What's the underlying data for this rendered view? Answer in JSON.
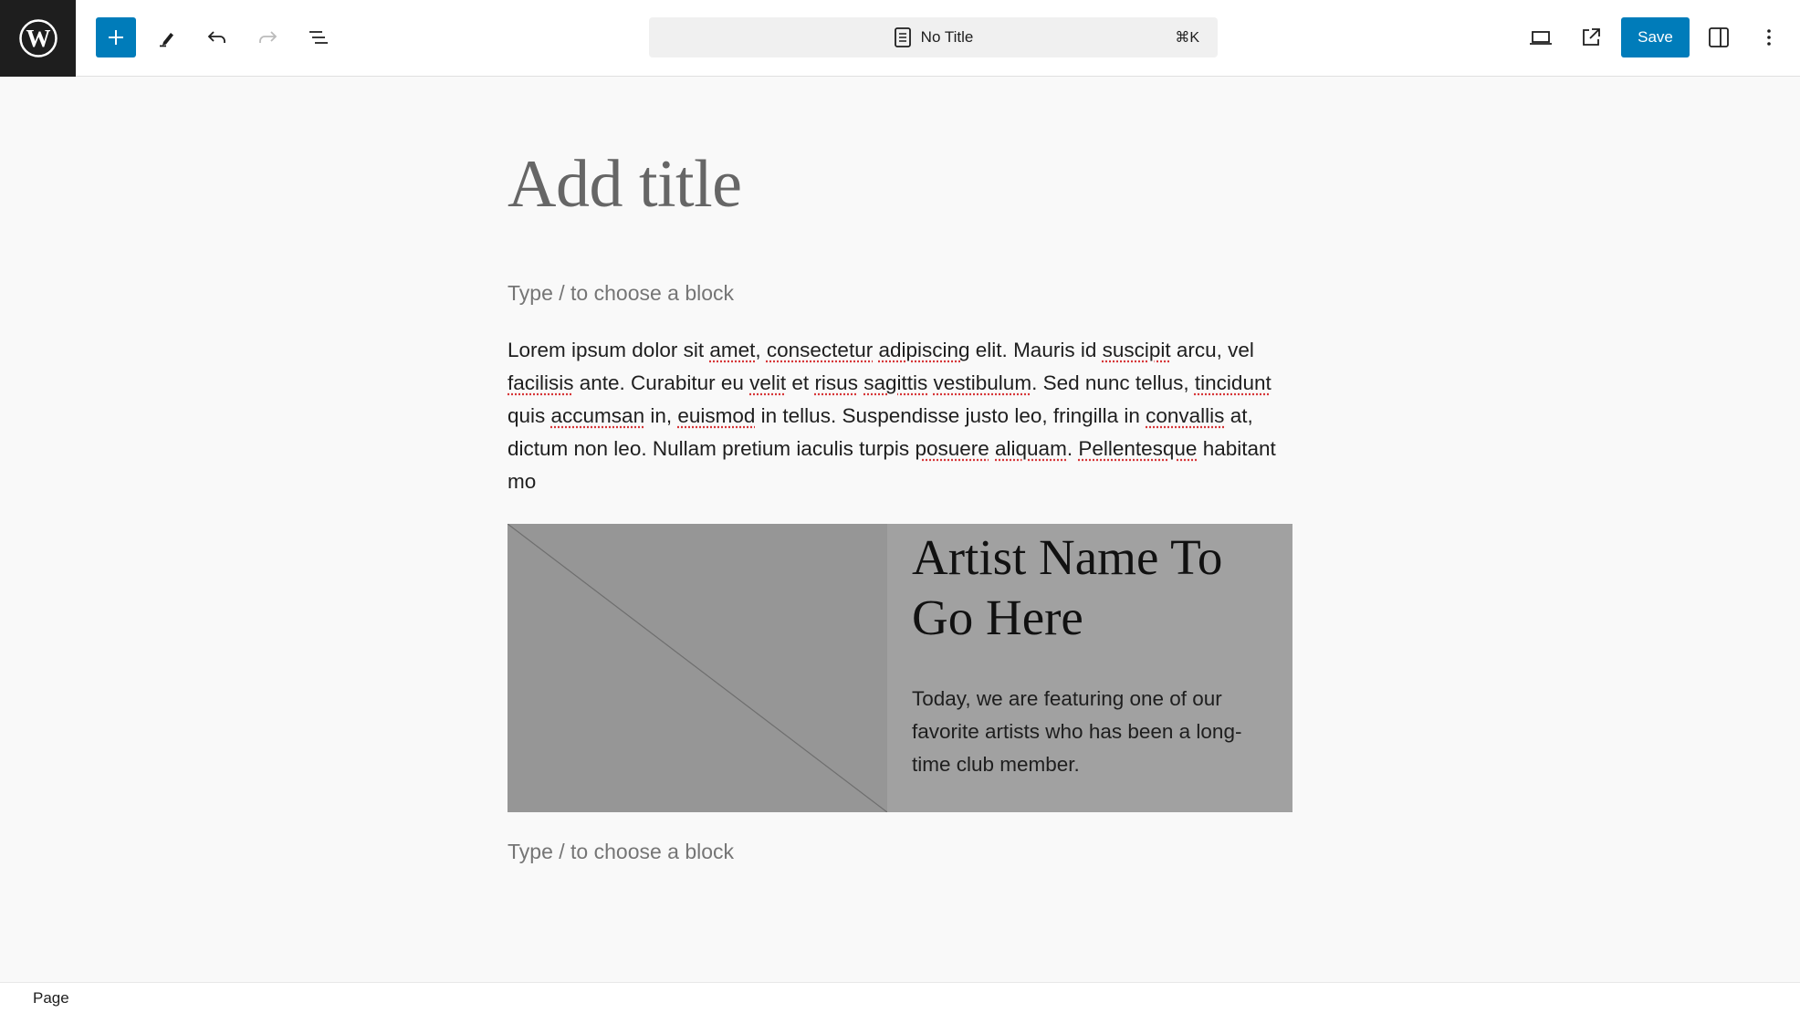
{
  "header": {
    "logo": "wordpress-logo",
    "toolbar": {
      "add_block": "Add block",
      "tools": "Tools",
      "undo": "Undo",
      "redo": "Redo",
      "list_view": "Document overview"
    },
    "document_bar": {
      "title": "No Title",
      "shortcut": "⌘K"
    },
    "right": {
      "view": "View",
      "preview": "View Page",
      "save_label": "Save",
      "settings": "Settings",
      "options": "Options"
    }
  },
  "colors": {
    "accent": "#007cba",
    "logo_bg": "#1e1e1e",
    "media_image_bg": "#969696",
    "media_panel_bg": "#a1a1a1"
  },
  "editor": {
    "title_placeholder": "Add title",
    "block_placeholder_1": "Type / to choose a block",
    "paragraph": {
      "segments": [
        [
          "Lorem ipsum dolor sit ",
          false
        ],
        [
          "amet",
          true
        ],
        [
          ", ",
          false
        ],
        [
          "consectetur",
          true
        ],
        [
          " ",
          false
        ],
        [
          "adipiscing",
          true
        ],
        [
          " elit. Mauris id ",
          false
        ],
        [
          "suscipit",
          true
        ],
        [
          " arcu, vel ",
          false
        ],
        [
          "facilisis",
          true
        ],
        [
          " ante. Curabitur eu ",
          false
        ],
        [
          "velit",
          true
        ],
        [
          " et ",
          false
        ],
        [
          "risus",
          true
        ],
        [
          " ",
          false
        ],
        [
          "sagittis",
          true
        ],
        [
          " ",
          false
        ],
        [
          "vestibulum",
          true
        ],
        [
          ". Sed nunc tellus, ",
          false
        ],
        [
          "tincidunt",
          true
        ],
        [
          " quis ",
          false
        ],
        [
          "accumsan",
          true
        ],
        [
          " in, ",
          false
        ],
        [
          "euismod",
          true
        ],
        [
          " in tellus. Suspendisse justo leo, fringilla in ",
          false
        ],
        [
          "convallis",
          true
        ],
        [
          " at, dictum non leo. Nullam pretium iaculis turpis ",
          false
        ],
        [
          "posuere",
          true
        ],
        [
          " ",
          false
        ],
        [
          "aliquam",
          true
        ],
        [
          ". ",
          false
        ],
        [
          "Pellentesque",
          true
        ],
        [
          " habitant mo",
          false
        ]
      ]
    },
    "media_text": {
      "heading": "Artist Name To Go Here",
      "body": "Today, we are featuring one of our favorite artists who has been a long-time club member."
    },
    "block_placeholder_2": "Type / to choose a block"
  },
  "footer": {
    "breadcrumb": "Page"
  }
}
